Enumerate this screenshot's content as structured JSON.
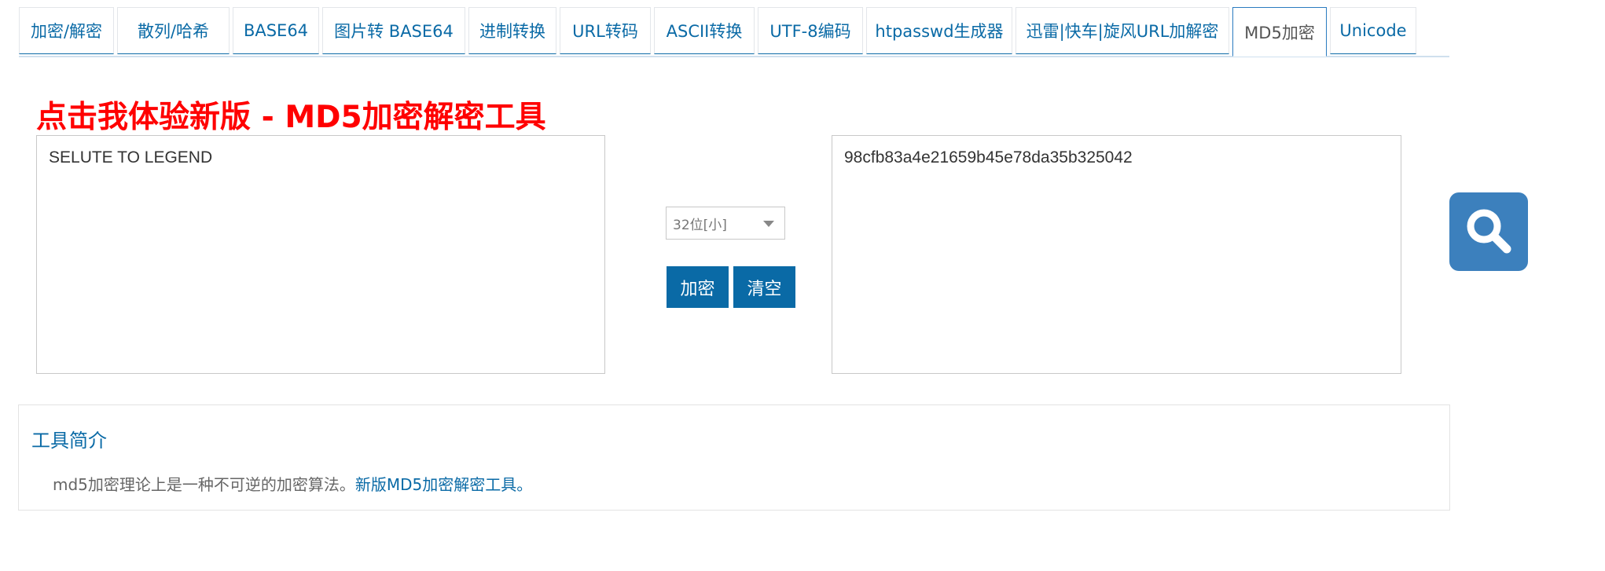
{
  "tabs": [
    {
      "label": "加密/解密"
    },
    {
      "label": "散列/哈希"
    },
    {
      "label": "BASE64"
    },
    {
      "label": "图片转 BASE64"
    },
    {
      "label": "进制转换"
    },
    {
      "label": "URL转码"
    },
    {
      "label": "ASCII转换"
    },
    {
      "label": "UTF-8编码"
    },
    {
      "label": "htpasswd生成器"
    },
    {
      "label": "迅雷|快车|旋风URL加解密"
    },
    {
      "label": "MD5加密",
      "active": true
    },
    {
      "label": "Unicode"
    }
  ],
  "headline": {
    "text": "点击我体验新版 - MD5加密解密工具",
    "color": "#ff0000"
  },
  "input": {
    "value": "SELUTE TO LEGEND"
  },
  "output": {
    "value": "98cfb83a4e21659b45e78da35b325042"
  },
  "controls": {
    "mode_select": {
      "selected": "32位[小]"
    },
    "encrypt_label": "加密",
    "clear_label": "清空"
  },
  "intro": {
    "title": "工具简介",
    "text": "md5加密理论上是一种不可逆的加密算法。",
    "link_text": "新版MD5加密解密工具。"
  },
  "float_search": {
    "icon": "search-icon"
  },
  "colors": {
    "accent": "#0a6aa6",
    "float_button": "#3c80bd",
    "headline": "#ff0000"
  }
}
